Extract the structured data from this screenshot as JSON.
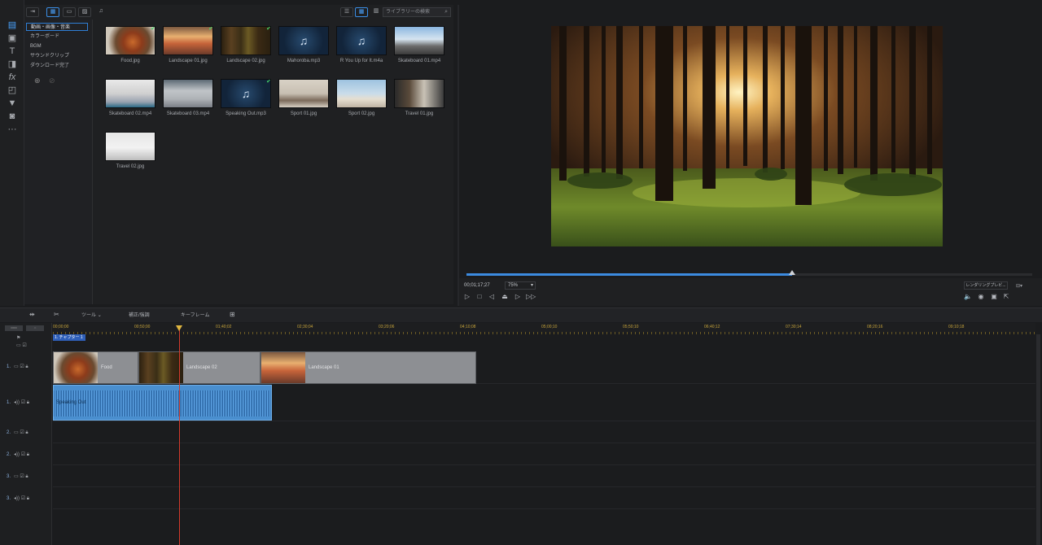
{
  "rail_icons": [
    "media-icon",
    "film-icon",
    "title-icon",
    "transition-icon",
    "fx-icon",
    "overlay-icon",
    "particle-icon",
    "subtitle-icon",
    "more-icon"
  ],
  "categories": [
    "動画・画像・音楽",
    "カラーボード",
    "BGM",
    "サウンドクリップ",
    "ダウンロード完了"
  ],
  "library_search_placeholder": "ライブラリーの検索",
  "media": [
    {
      "name": "Food.jpg",
      "kind": "image",
      "scene": "food",
      "checked": true
    },
    {
      "name": "Landscape 01.jpg",
      "kind": "image",
      "scene": "sunset",
      "checked": true
    },
    {
      "name": "Landscape 02.jpg",
      "kind": "image",
      "scene": "forest",
      "checked": true
    },
    {
      "name": "Mahoroba.mp3",
      "kind": "music",
      "checked": false
    },
    {
      "name": "R You Up for It.m4a",
      "kind": "music",
      "checked": false
    },
    {
      "name": "Skateboard 01.mp4",
      "kind": "video",
      "scene": "city",
      "checked": false
    },
    {
      "name": "Skateboard 02.mp4",
      "kind": "video",
      "scene": "skate",
      "checked": false
    },
    {
      "name": "Skateboard 03.mp4",
      "kind": "video",
      "scene": "skate2",
      "checked": false
    },
    {
      "name": "Speaking Out.mp3",
      "kind": "music",
      "checked": true
    },
    {
      "name": "Sport 01.jpg",
      "kind": "image",
      "scene": "sport",
      "checked": false
    },
    {
      "name": "Sport 02.jpg",
      "kind": "image",
      "scene": "beach",
      "checked": false
    },
    {
      "name": "Travel 01.jpg",
      "kind": "image",
      "scene": "travel",
      "checked": false
    },
    {
      "name": "Travel 02.jpg",
      "kind": "image",
      "scene": "airport",
      "checked": false
    }
  ],
  "preview": {
    "timecode": "00;01;17;27",
    "zoom": "75%",
    "render_button": "レンダリングプレビ...",
    "scrub_progress": 0.58
  },
  "timeline_toolbar": {
    "tools": "ツール",
    "fix": "補正/強調",
    "keyframe": "キーフレーム"
  },
  "ruler_ticks": [
    "00;00;00",
    "00;50;00",
    "01;40;02",
    "02;30;04",
    "03;20;06",
    "04;10;08",
    "05;00;10",
    "05;50;10",
    "06;40;12",
    "07;30;14",
    "08;20;16",
    "09;10;18"
  ],
  "chapter_label": "1. チャプター 1",
  "tracks": [
    "1.",
    "1.",
    "2.",
    "2.",
    "3.",
    "3."
  ],
  "clips": [
    {
      "label": "Food",
      "scene": "food"
    },
    {
      "label": "Landscape 02",
      "scene": "forest"
    },
    {
      "label": "Landscape 01",
      "scene": "sunset"
    }
  ],
  "audio_clip": "Speaking Out"
}
